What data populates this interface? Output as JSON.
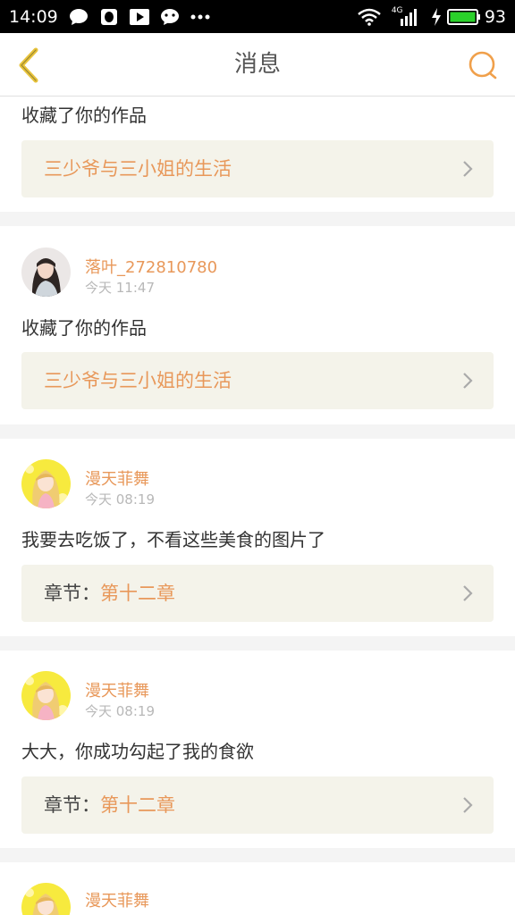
{
  "status_bar": {
    "time": "14:09",
    "network": "4G",
    "battery": "93",
    "icons": [
      "chat-bubble-icon",
      "qq-penguin-icon",
      "play-icon",
      "wechat-icon",
      "more-dots-icon",
      "wifi-icon",
      "signal-icon",
      "charging-icon",
      "battery-icon"
    ]
  },
  "header": {
    "title": "消息",
    "back_icon": "back-arrow-icon",
    "search_icon": "search-icon",
    "accent": "#f0a04b"
  },
  "messages": [
    {
      "text": "收藏了你的作品",
      "link_value": "三少爷与三小姐的生活"
    },
    {
      "user": "落叶_272810780",
      "time": "今天 11:47",
      "text": "收藏了你的作品",
      "link_value": "三少爷与三小姐的生活"
    },
    {
      "user": "漫天菲舞",
      "time": "今天 08:19",
      "text": "我要去吃饭了，不看这些美食的图片了",
      "link_label": "章节：",
      "link_value": "第十二章"
    },
    {
      "user": "漫天菲舞",
      "time": "今天 08:19",
      "text": "大大，你成功勾起了我的食欲",
      "link_label": "章节：",
      "link_value": "第十二章"
    },
    {
      "user": "漫天菲舞"
    }
  ],
  "colors": {
    "accent": "#e8985a",
    "link_bg": "#f4f3ea",
    "page_bg": "#f4f4f4"
  }
}
